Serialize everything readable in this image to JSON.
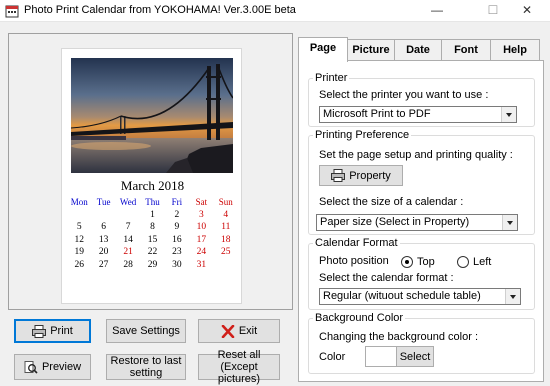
{
  "window": {
    "title": "Photo Print Calendar from YOKOHAMA! Ver.3.00E beta",
    "controls": {
      "minimize": "—",
      "maximize": "☐",
      "close": "✕"
    }
  },
  "calendar": {
    "month_title": "March 2018",
    "weekdays": [
      "Mon",
      "Tue",
      "Wed",
      "Thu",
      "Fri",
      "Sat",
      "Sun"
    ],
    "weeks": [
      [
        "",
        "",
        "",
        "1",
        "2",
        "3",
        "4"
      ],
      [
        "5",
        "6",
        "7",
        "8",
        "9",
        "10",
        "11"
      ],
      [
        "12",
        "13",
        "14",
        "15",
        "16",
        "17",
        "18"
      ],
      [
        "19",
        "20",
        "21",
        "22",
        "23",
        "24",
        "25"
      ],
      [
        "26",
        "27",
        "28",
        "29",
        "30",
        "31",
        ""
      ]
    ],
    "holiday": "21",
    "colors": {
      "weekday_header": "#0000cc",
      "saturday": "#cc0000",
      "sunday": "#cc0000",
      "holiday": "#cc0000"
    }
  },
  "buttons": {
    "print": "Print",
    "save_settings": "Save Settings",
    "exit": "Exit",
    "preview": "Preview",
    "restore": "Restore to last setting",
    "reset_all": "Reset all (Except pictures)"
  },
  "tabs": [
    "Page",
    "Picture",
    "Date",
    "Font",
    "Help"
  ],
  "active_tab": "Page",
  "page_tab": {
    "printer": {
      "group_label": "Printer",
      "prompt": "Select the printer you want to use :",
      "selected": "Microsoft Print to PDF"
    },
    "printing_preference": {
      "group_label": "Printing Preference",
      "prompt": "Set the page setup and printing quality :",
      "property_button": "Property",
      "size_prompt": "Select the size of a calendar :",
      "size_selected": "Paper size (Select in Property)"
    },
    "calendar_format": {
      "group_label": "Calendar Format",
      "photo_position_label": "Photo position",
      "option_top": "Top",
      "option_left": "Left",
      "selected_position": "Top",
      "format_prompt": "Select the calendar format :",
      "format_selected": "Regular (wituout schedule table)"
    },
    "background_color": {
      "group_label": "Background Color",
      "prompt": "Changing the background color :",
      "color_label": "Color",
      "select_button": "Select",
      "current_color": "#ffffff"
    }
  }
}
